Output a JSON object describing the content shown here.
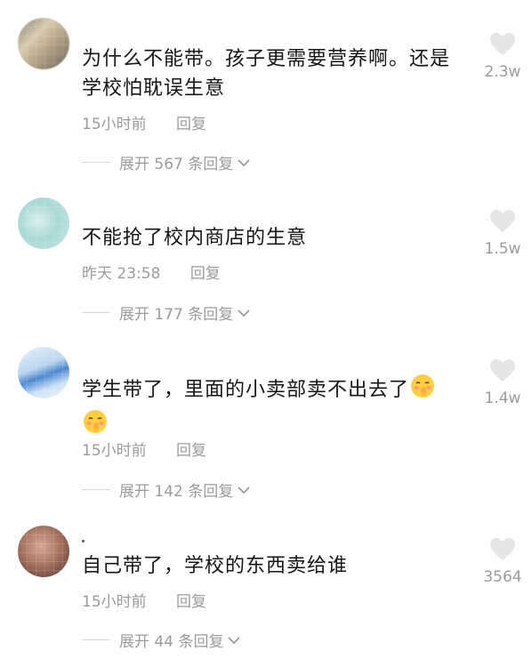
{
  "comments": [
    {
      "text": "为什么不能带。孩子更需要营养啊。还是学校怕耽误生意",
      "time": "15小时前",
      "reply": "回复",
      "expand": "展开 567 条回复",
      "likes": "2.3w"
    },
    {
      "text": "不能抢了校内商店的生意",
      "time": "昨天 23:58",
      "reply": "回复",
      "expand": "展开 177 条回复",
      "likes": "1.5w"
    },
    {
      "text": "学生带了，里面的小卖部卖不出去了",
      "time": "15小时前",
      "reply": "回复",
      "expand": "展开 142 条回复",
      "likes": "1.4w"
    },
    {
      "text": "自己带了，学校的东西卖给谁",
      "time": "15小时前",
      "reply": "回复",
      "expand": "展开 44 条回复",
      "likes": "3564"
    }
  ],
  "icons": {
    "like": "heart-icon",
    "expand": "chevron-down-icon",
    "emoji": "shush-face-emoji"
  },
  "colors": {
    "text": "#161616",
    "muted": "#9b9b9b",
    "heart": "#e6e6e6"
  }
}
